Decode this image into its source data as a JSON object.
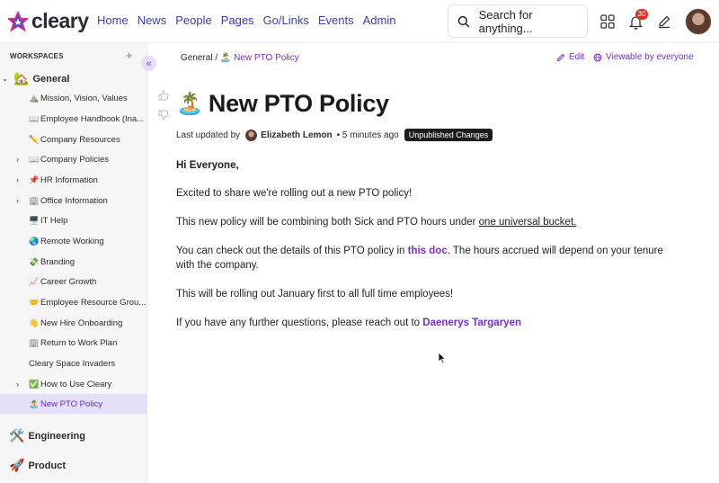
{
  "app": {
    "logo_text": "cleary",
    "nav": [
      "Home",
      "News",
      "People",
      "Pages",
      "Go/Links",
      "Events",
      "Admin"
    ],
    "active_nav": "Pages",
    "search_placeholder": "Search for anything...",
    "notification_count": "30",
    "accent": "#7a2fc9",
    "nav_color": "#3f3fa6"
  },
  "sidebar": {
    "header": "WORKSPACES",
    "add_label": "+",
    "collapse_label": "«",
    "groups": {
      "general": {
        "label": "General",
        "icon": "🏡"
      },
      "engineering": {
        "label": "Engineering",
        "icon": "🛠️"
      },
      "product": {
        "label": "Product",
        "icon": "🚀"
      }
    },
    "items": [
      {
        "label": "Mission, Vision, Values",
        "emoji": "⛰️",
        "has_children": false
      },
      {
        "label": "Employee Handbook (Ina...",
        "emoji": "📖",
        "has_children": false
      },
      {
        "label": "Company Resources",
        "emoji": "✏️",
        "has_children": false
      },
      {
        "label": "Company Policies",
        "emoji": "📖",
        "has_children": true
      },
      {
        "label": "HR Information",
        "emoji": "📌",
        "has_children": true
      },
      {
        "label": "Office Information",
        "emoji": "🏢",
        "has_children": true
      },
      {
        "label": "IT Help",
        "emoji": "🖥️",
        "has_children": false
      },
      {
        "label": "Remote Working",
        "emoji": "🌏",
        "has_children": false
      },
      {
        "label": "Branding",
        "emoji": "💸",
        "has_children": false
      },
      {
        "label": "Career Growth",
        "emoji": "📈",
        "has_children": false
      },
      {
        "label": "Employee Resource Grou...",
        "emoji": "🤝",
        "has_children": false
      },
      {
        "label": "New Hire Onboarding",
        "emoji": "👋",
        "has_children": false
      },
      {
        "label": "Return to Work Plan",
        "emoji": "🏢",
        "has_children": false
      },
      {
        "label": "Cleary Space Invaders",
        "emoji": "",
        "has_children": false
      },
      {
        "label": "How to Use Cleary",
        "emoji": "✅",
        "has_children": true
      },
      {
        "label": "New PTO Policy",
        "emoji": "🏝️",
        "has_children": false,
        "selected": true
      }
    ]
  },
  "page": {
    "breadcrumb_parent": "General /",
    "breadcrumb_current": "🏝️ New PTO Policy",
    "edit_label": "Edit",
    "visibility_label": "Viewable by everyone",
    "title_emoji": "🏝️",
    "title": "New PTO Policy",
    "updated_prefix": "Last updated by",
    "author": "Elizabeth Lemon",
    "updated_time": "• 5 minutes ago",
    "status_badge": "Unpublished Changes",
    "greeting": "Hi Everyone,",
    "p1": "Excited to share we're rolling out a new PTO policy!",
    "p2_pre": "This new policy will be combining both Sick and PTO hours under ",
    "p2_link": "one universal bucket.",
    "p3_pre": "You can check out the details of this PTO policy in ",
    "p3_link": "this doc",
    "p3_post": ". The hours accrued will depend on your tenure with the company.",
    "p4": "This will be rolling out January first to all full time employees!",
    "p5_pre": "If you have any further questions, please reach out to ",
    "p5_link": "Daenerys Targaryen"
  }
}
